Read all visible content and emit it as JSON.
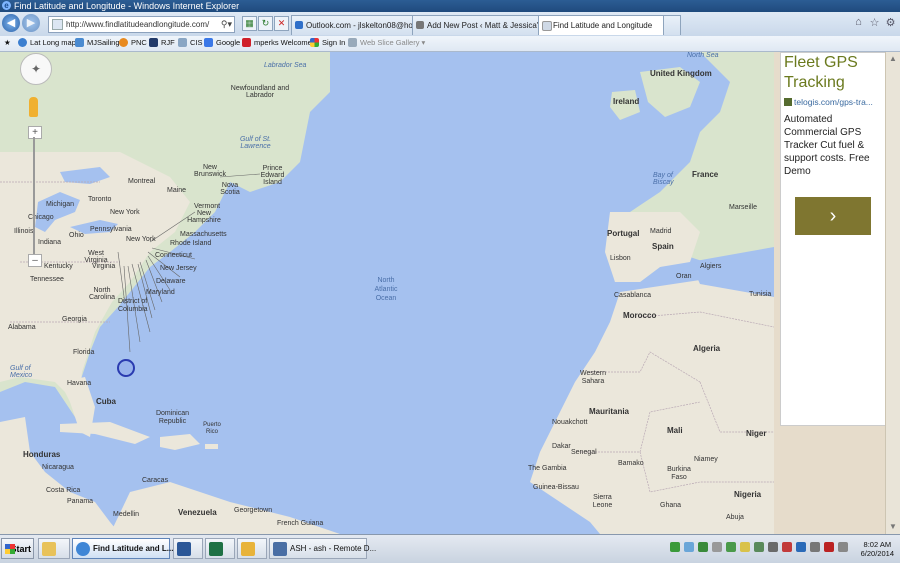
{
  "window": {
    "title": "Find Latitude and Longitude - Windows Internet Explorer"
  },
  "address_bar": {
    "url": "http://www.findlatitudeandlongitude.com/"
  },
  "tabs": [
    {
      "label": "Outlook.com - jlskelton08@hot...",
      "active": false
    },
    {
      "label": "Add New Post ‹ Matt & Jessica's ...",
      "active": false
    },
    {
      "label": "Find Latitude and Longitude",
      "active": true
    }
  ],
  "favorites": [
    {
      "label": "Lat Long map",
      "icon": "globe-icon",
      "dim": false
    },
    {
      "label": "MJSailing",
      "icon": "sail-icon",
      "dim": false
    },
    {
      "label": "PNC",
      "icon": "pnc-icon",
      "dim": false
    },
    {
      "label": "RJF",
      "icon": "rjf-icon",
      "dim": false
    },
    {
      "label": "CIS",
      "icon": "cis-icon",
      "dim": false
    },
    {
      "label": "Google",
      "icon": "google-icon",
      "dim": false
    },
    {
      "label": "mperks Welcome",
      "icon": "mperks-icon",
      "dim": false
    },
    {
      "label": "Sign In",
      "icon": "windows-icon",
      "dim": false
    },
    {
      "label": "Web Slice Gallery ▾",
      "icon": "webslice-icon",
      "dim": true
    }
  ],
  "map": {
    "labels": [
      {
        "text": "North Sea",
        "kind": "water"
      },
      {
        "text": "United Kingdom",
        "kind": "country"
      },
      {
        "text": "Ireland",
        "kind": "country"
      },
      {
        "text": "Labrador Sea",
        "kind": "water"
      },
      {
        "text": "Newfoundland and Labrador",
        "kind": "place"
      },
      {
        "text": "Gulf of St. Lawrence",
        "kind": "water"
      },
      {
        "text": "Prince Edward Island",
        "kind": "place"
      },
      {
        "text": "New Brunswick",
        "kind": "place"
      },
      {
        "text": "Nova Scotia",
        "kind": "place"
      },
      {
        "text": "Montreal",
        "kind": "place"
      },
      {
        "text": "Maine",
        "kind": "place"
      },
      {
        "text": "Michigan",
        "kind": "place"
      },
      {
        "text": "Toronto",
        "kind": "place"
      },
      {
        "text": "Vermont",
        "kind": "place"
      },
      {
        "text": "New York",
        "kind": "place"
      },
      {
        "text": "New Hampshire",
        "kind": "place"
      },
      {
        "text": "Chicago",
        "kind": "place"
      },
      {
        "text": "Massachusetts",
        "kind": "place"
      },
      {
        "text": "Pennsylvania",
        "kind": "place"
      },
      {
        "text": "Illinois",
        "kind": "place"
      },
      {
        "text": "Ohio",
        "kind": "place"
      },
      {
        "text": "Indiana",
        "kind": "place"
      },
      {
        "text": "New York",
        "kind": "place"
      },
      {
        "text": "Rhode Island",
        "kind": "place"
      },
      {
        "text": "Connecticut",
        "kind": "place"
      },
      {
        "text": "West Virginia",
        "kind": "place"
      },
      {
        "text": "Kentucky",
        "kind": "place"
      },
      {
        "text": "Virginia",
        "kind": "place"
      },
      {
        "text": "New Jersey",
        "kind": "place"
      },
      {
        "text": "Delaware",
        "kind": "place"
      },
      {
        "text": "Tennessee",
        "kind": "place"
      },
      {
        "text": "North Carolina",
        "kind": "place"
      },
      {
        "text": "Maryland",
        "kind": "place"
      },
      {
        "text": "District of Columbia",
        "kind": "place"
      },
      {
        "text": "Georgia",
        "kind": "place"
      },
      {
        "text": "Alabama",
        "kind": "place"
      },
      {
        "text": "Florida",
        "kind": "place"
      },
      {
        "text": "Gulf of Mexico",
        "kind": "water"
      },
      {
        "text": "North Atlantic Ocean",
        "kind": "ocean"
      },
      {
        "text": "Havana",
        "kind": "place"
      },
      {
        "text": "Cuba",
        "kind": "country"
      },
      {
        "text": "Dominican Republic",
        "kind": "place"
      },
      {
        "text": "Puerto Rico",
        "kind": "place"
      },
      {
        "text": "Honduras",
        "kind": "country"
      },
      {
        "text": "Nicaragua",
        "kind": "place"
      },
      {
        "text": "Costa Rica",
        "kind": "place"
      },
      {
        "text": "Panama",
        "kind": "place"
      },
      {
        "text": "Caracas",
        "kind": "place"
      },
      {
        "text": "Medellin",
        "kind": "place"
      },
      {
        "text": "Venezuela",
        "kind": "country"
      },
      {
        "text": "Georgetown",
        "kind": "place"
      },
      {
        "text": "French Guiana",
        "kind": "place"
      },
      {
        "text": "Bay of Biscay",
        "kind": "water"
      },
      {
        "text": "France",
        "kind": "country"
      },
      {
        "text": "Portugal",
        "kind": "country"
      },
      {
        "text": "Madrid",
        "kind": "place"
      },
      {
        "text": "Spain",
        "kind": "country"
      },
      {
        "text": "Lisbon",
        "kind": "place"
      },
      {
        "text": "Marseille",
        "kind": "place"
      },
      {
        "text": "Algiers",
        "kind": "place"
      },
      {
        "text": "Tunisia",
        "kind": "place"
      },
      {
        "text": "Oran",
        "kind": "place"
      },
      {
        "text": "Casablanca",
        "kind": "place"
      },
      {
        "text": "Morocco",
        "kind": "country"
      },
      {
        "text": "Algeria",
        "kind": "country"
      },
      {
        "text": "Western Sahara",
        "kind": "place"
      },
      {
        "text": "Mauritania",
        "kind": "country"
      },
      {
        "text": "Mali",
        "kind": "country"
      },
      {
        "text": "Niger",
        "kind": "country"
      },
      {
        "text": "Nouakchott",
        "kind": "place"
      },
      {
        "text": "Dakar",
        "kind": "place"
      },
      {
        "text": "Senegal",
        "kind": "place"
      },
      {
        "text": "The Gambia",
        "kind": "place"
      },
      {
        "text": "Bamako",
        "kind": "place"
      },
      {
        "text": "Burkina Faso",
        "kind": "place"
      },
      {
        "text": "Niamey",
        "kind": "place"
      },
      {
        "text": "Guinea-Bissau",
        "kind": "place"
      },
      {
        "text": "Sierra Leone",
        "kind": "place"
      },
      {
        "text": "Nigeria",
        "kind": "country"
      },
      {
        "text": "Ghana",
        "kind": "place"
      },
      {
        "text": "Abuja",
        "kind": "place"
      }
    ]
  },
  "ad": {
    "headline": "Fleet GPS Tracking",
    "link": "telogis.com/gps-tra...",
    "body": "Automated Commercial GPS Tracker Cut fuel & support costs. Free Demo",
    "go": "›"
  },
  "taskbar": {
    "start": "Start",
    "items": [
      {
        "label": "",
        "icon": "folder-icon"
      },
      {
        "label": "Find Latitude and L...",
        "icon": "ie-icon",
        "active": true
      },
      {
        "label": "",
        "icon": "word-icon"
      },
      {
        "label": "",
        "icon": "excel-icon"
      },
      {
        "label": "",
        "icon": "paint-icon"
      },
      {
        "label": "ASH - ash - Remote D...",
        "icon": "remote-desktop-icon"
      }
    ],
    "time": "8:02 AM",
    "date": "6/20/2014"
  },
  "colors": {
    "water": "#a5c1ef",
    "land": "#e9e6dc",
    "land_north": "#d6e2c6",
    "ad_headline": "#6b7a1e",
    "ad_button": "#7f7630"
  }
}
